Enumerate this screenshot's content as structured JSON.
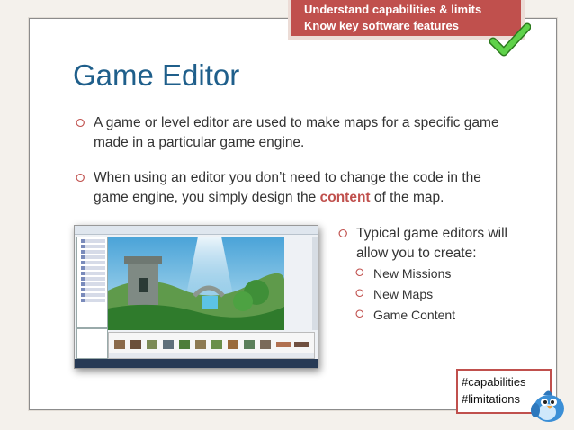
{
  "banner": {
    "line1": "Understand capabilities & limits",
    "line2": "Know key software features"
  },
  "slide": {
    "title": "Game Editor",
    "bullets": [
      {
        "text": "A game or level editor are used to make maps for a specific game made in a particular game engine."
      },
      {
        "text_before": "When using an editor you don’t need to change the code in the game engine, you simply design the ",
        "highlight": "content",
        "text_after": " of the map."
      },
      {
        "text": "Typical game editors will allow you to create:"
      }
    ],
    "sub_bullets": [
      "New Missions",
      "New Maps",
      "Game Content"
    ]
  },
  "tags": [
    "#capabilities",
    "#limitations"
  ],
  "icons": {
    "bullet": "square-bullet-icon",
    "check": "green-checkmark-icon",
    "bird": "twitter-bird-icon"
  },
  "colors": {
    "accent": "#c0504d",
    "title": "#1f5f8b",
    "check": "#3fae29",
    "bird": "#3b8fd6"
  }
}
